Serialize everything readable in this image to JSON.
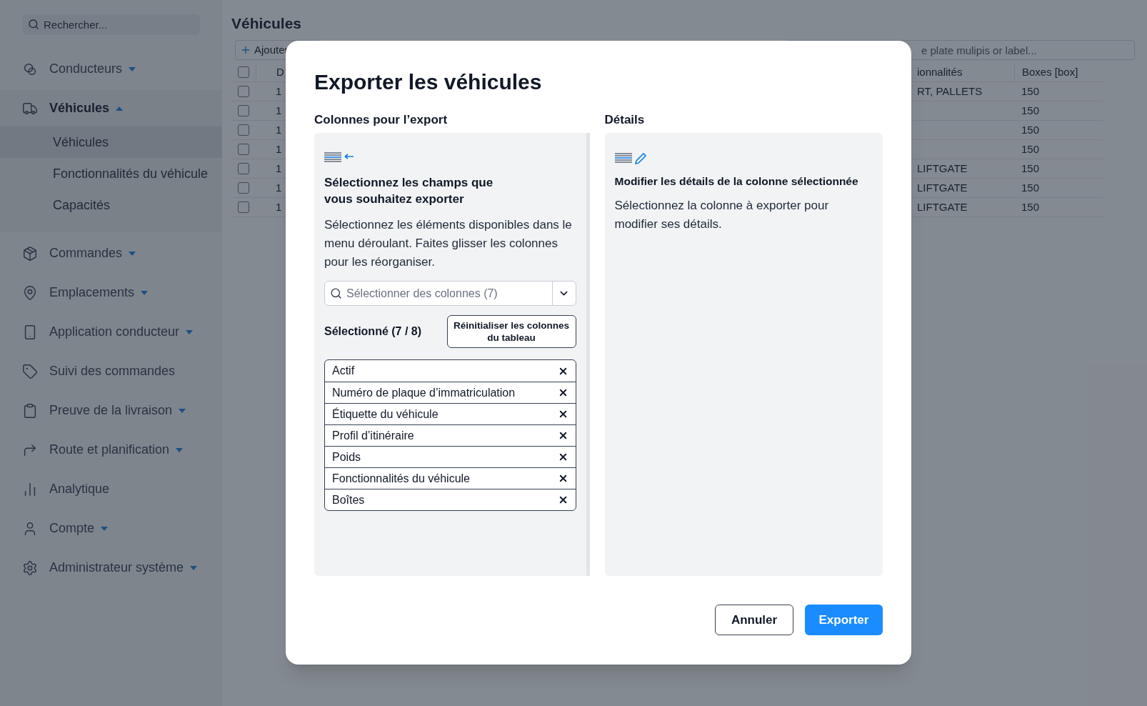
{
  "sidebar": {
    "search": {
      "placeholder": "Rechercher..."
    },
    "items": [
      {
        "label": "Conducteurs",
        "expanded": false
      },
      {
        "label": "Véhicules",
        "expanded": true,
        "children": [
          {
            "label": "Véhicules",
            "selected": true
          },
          {
            "label": "Fonctionnalités du véhicule",
            "selected": false
          },
          {
            "label": "Capacités",
            "selected": false
          }
        ]
      },
      {
        "label": "Commandes",
        "expanded": false
      },
      {
        "label": "Emplacements",
        "expanded": false
      },
      {
        "label": "Application conducteur",
        "expanded": false
      },
      {
        "label": "Suivi des commandes"
      },
      {
        "label": "Preuve de la livraison",
        "expanded": false
      },
      {
        "label": "Route et planification",
        "expanded": false
      },
      {
        "label": "Analytique"
      },
      {
        "label": "Compte",
        "expanded": false
      },
      {
        "label": "Administrateur système",
        "expanded": false
      }
    ]
  },
  "page": {
    "title": "Véhicules",
    "add_button": "Ajouter",
    "search": {
      "placeholder": "e plate mulipis or label..."
    },
    "table": {
      "header_checked": false,
      "columns": {
        "column_2": "D",
        "column_3": "ionnalités",
        "column_4": "Boxes [box]"
      },
      "rows": [
        {
          "checked": false,
          "column_2": "1",
          "column_3": "RT, PALLETS",
          "column_4": "150"
        },
        {
          "checked": false,
          "column_2": "1",
          "column_4": "150"
        },
        {
          "checked": false,
          "column_2": "1",
          "column_4": "150"
        },
        {
          "checked": false,
          "column_2": "1",
          "column_4": "150"
        },
        {
          "checked": false,
          "column_2": "1",
          "column_3": "LIFTGATE",
          "column_4": "150"
        },
        {
          "checked": false,
          "column_2": "1",
          "column_3": "LIFTGATE",
          "column_4": "150"
        },
        {
          "checked": false,
          "column_2": "1",
          "column_3": "LIFTGATE",
          "column_4": "150"
        }
      ]
    }
  },
  "dialog": {
    "title": "Exporter les véhicules",
    "columns_section": {
      "heading": "Colonnes pour l’export",
      "panel_heading": "Sélectionnez les champs que vous souhaitez exporter",
      "description": "Sélectionnez les éléments disponibles dans le menu déroulant. Faites glisser les colonnes pour les réorganiser.",
      "select": {
        "placeholder": "Sélectionner des colonnes (7)"
      },
      "selected_label": "Sélectionné (7 / 8)",
      "reset_button": "Réinitialiser les colonnes du tableau",
      "selected_columns": [
        "Actif",
        "Numéro de plaque d’immatriculation",
        "Étiquette du véhicule",
        "Profil d’itinéraire",
        "Poids",
        "Fonctionnalités du véhicule",
        "Boîtes"
      ]
    },
    "details_section": {
      "heading": "Détails",
      "panel_heading": "Modifier les détails de la colonne sélectionnée",
      "description": "Sélectionnez la colonne à exporter pour modifier ses détails."
    },
    "buttons": {
      "cancel": "Annuler",
      "export": "Exporter"
    }
  }
}
